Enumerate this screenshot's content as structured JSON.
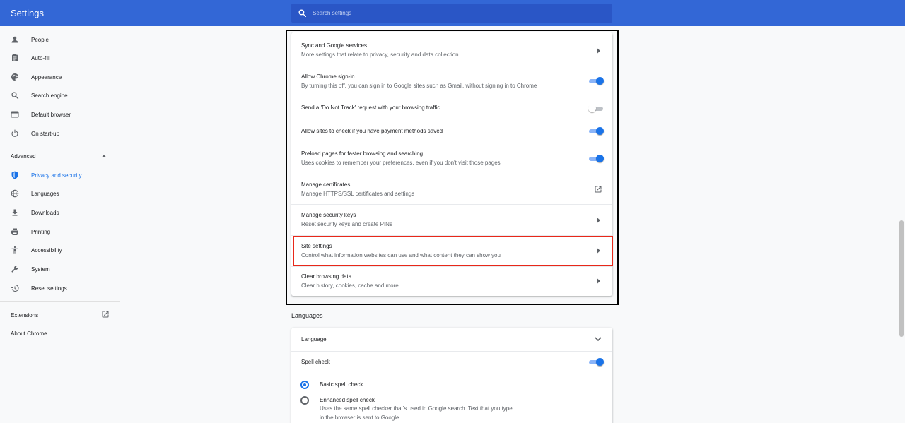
{
  "app": {
    "title": "Settings"
  },
  "search": {
    "placeholder": "Search settings"
  },
  "sidebar": {
    "items": [
      {
        "label": "People",
        "icon": "person-icon"
      },
      {
        "label": "Auto-fill",
        "icon": "clipboard-icon"
      },
      {
        "label": "Appearance",
        "icon": "palette-icon"
      },
      {
        "label": "Search engine",
        "icon": "search-icon"
      },
      {
        "label": "Default browser",
        "icon": "browser-window-icon"
      },
      {
        "label": "On start-up",
        "icon": "power-icon"
      }
    ],
    "advanced": {
      "label": "Advanced",
      "expanded": true
    },
    "advanced_items": [
      {
        "label": "Privacy and security",
        "icon": "shield-icon",
        "active": true
      },
      {
        "label": "Languages",
        "icon": "globe-icon"
      },
      {
        "label": "Downloads",
        "icon": "download-icon"
      },
      {
        "label": "Printing",
        "icon": "printer-icon"
      },
      {
        "label": "Accessibility",
        "icon": "accessibility-icon"
      },
      {
        "label": "System",
        "icon": "wrench-icon"
      },
      {
        "label": "Reset settings",
        "icon": "restore-icon"
      }
    ],
    "extensions": {
      "label": "Extensions",
      "icon": "open-in-new-icon"
    },
    "about": {
      "label": "About Chrome"
    }
  },
  "privacy": {
    "rows": [
      {
        "title": "Sync and Google services",
        "subtitle": "More settings that relate to privacy, security and data collection",
        "control": "arrow"
      },
      {
        "title": "Allow Chrome sign-in",
        "subtitle": "By turning this off, you can sign in to Google sites such as Gmail, without signing in to Chrome",
        "control": "toggle",
        "on": true
      },
      {
        "title": "Send a 'Do Not Track' request with your browsing traffic",
        "control": "toggle",
        "on": false
      },
      {
        "title": "Allow sites to check if you have payment methods saved",
        "control": "toggle",
        "on": true
      },
      {
        "title": "Preload pages for faster browsing and searching",
        "subtitle": "Uses cookies to remember your preferences, even if you don't visit those pages",
        "control": "toggle",
        "on": true
      },
      {
        "title": "Manage certificates",
        "subtitle": "Manage HTTPS/SSL certificates and settings",
        "control": "external-link"
      },
      {
        "title": "Manage security keys",
        "subtitle": "Reset security keys and create PINs",
        "control": "arrow"
      },
      {
        "title": "Site settings",
        "subtitle": "Control what information websites can use and what content they can show you",
        "control": "arrow",
        "highlighted": true
      },
      {
        "title": "Clear browsing data",
        "subtitle": "Clear history, cookies, cache and more",
        "control": "arrow"
      }
    ]
  },
  "languages": {
    "section_title": "Languages",
    "language_row": {
      "label": "Language"
    },
    "spell_check": {
      "label": "Spell check",
      "on": true
    },
    "options": [
      {
        "label": "Basic spell check",
        "checked": true
      },
      {
        "label": "Enhanced spell check",
        "checked": false,
        "subtitle_line1": "Uses the same spell checker that's used in Google search. Text that you type",
        "subtitle_line2": "in the browser is sent to Google."
      }
    ]
  },
  "colors": {
    "header": "#3367d6",
    "search_bg": "#2a56c6",
    "accent": "#1a73e8",
    "highlight_border": "#e8281a",
    "outline_border": "#000000"
  }
}
